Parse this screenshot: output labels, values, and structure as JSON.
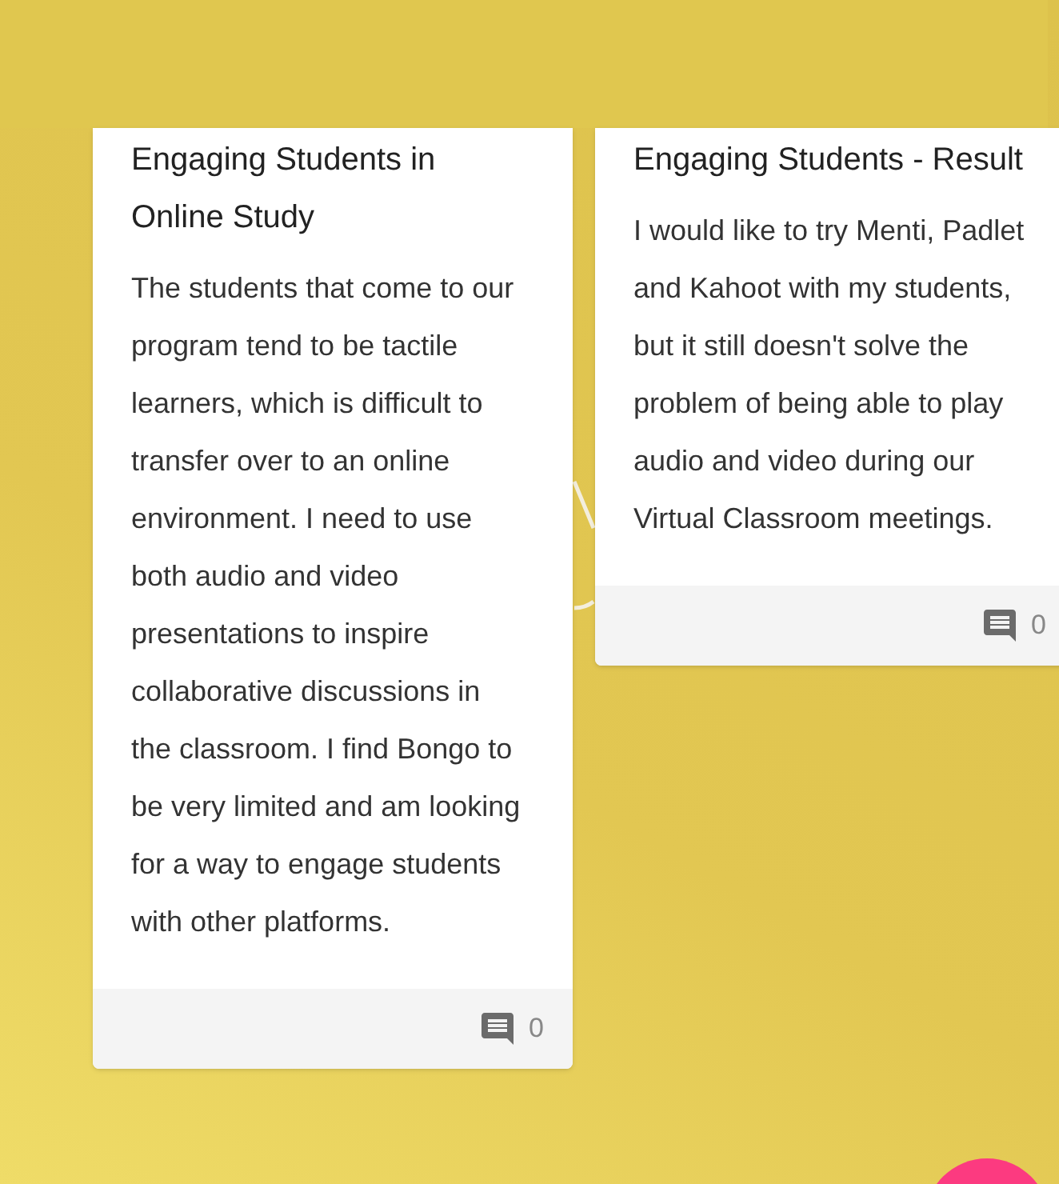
{
  "cards": [
    {
      "title": "Engaging Students in Online Study",
      "body": "The students that come to our program tend to be tactile learners, which is difficult to transfer over to an online environment. I need to use both audio and video  presentations to inspire collaborative discussions in the classroom. I find Bongo to be very limited and am looking for a way to engage students with other platforms.",
      "comment_count": "0"
    },
    {
      "title": "Engaging Students - Result",
      "body": "I would like to try Menti, Padlet and Kahoot with my students, but it still doesn't solve the problem of being able to play audio and video during our Virtual Classroom meetings.",
      "comment_count": "0"
    }
  ]
}
